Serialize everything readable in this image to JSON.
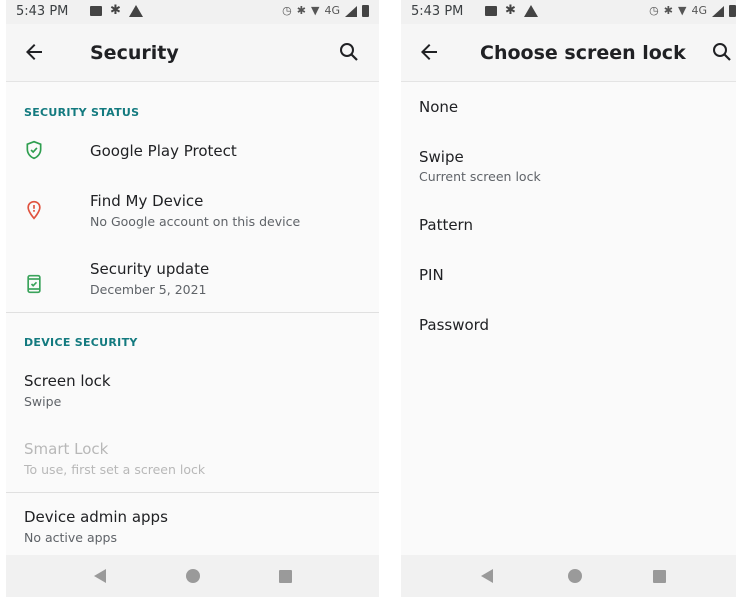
{
  "left": {
    "status_bar": {
      "time": "5:43 PM",
      "network": "4G"
    },
    "app_bar": {
      "title": "Security"
    },
    "sections": [
      {
        "header": "SECURITY STATUS",
        "items": [
          {
            "title": "Google Play Protect",
            "subtitle": "",
            "icon": "shield-check-icon"
          },
          {
            "title": "Find My Device",
            "subtitle": "No Google account on this device",
            "icon": "location-alert-icon"
          },
          {
            "title": "Security update",
            "subtitle": "December 5, 2021",
            "icon": "phone-check-icon"
          }
        ]
      },
      {
        "header": "DEVICE SECURITY",
        "items": [
          {
            "title": "Screen lock",
            "subtitle": "Swipe",
            "enabled": true
          },
          {
            "title": "Smart Lock",
            "subtitle": "To use, first set a screen lock",
            "enabled": false
          },
          {
            "title": "Device admin apps",
            "subtitle": "No active apps",
            "enabled": true
          }
        ]
      }
    ]
  },
  "right": {
    "status_bar": {
      "time": "5:43 PM",
      "network": "4G"
    },
    "app_bar": {
      "title": "Choose screen lock"
    },
    "options": [
      {
        "label": "None",
        "subtitle": ""
      },
      {
        "label": "Swipe",
        "subtitle": "Current screen lock"
      },
      {
        "label": "Pattern",
        "subtitle": ""
      },
      {
        "label": "PIN",
        "subtitle": ""
      },
      {
        "label": "Password",
        "subtitle": ""
      }
    ]
  },
  "colors": {
    "accent": "#137a7f",
    "protect_green": "#2e9e4f",
    "find_red": "#e0533f",
    "update_green": "#3aa35b"
  }
}
